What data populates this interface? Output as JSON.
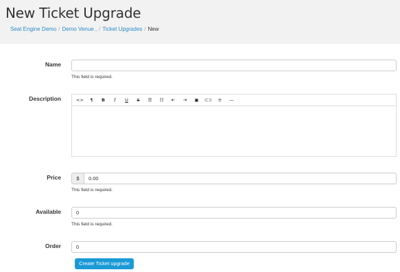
{
  "page": {
    "title": "New Ticket Upgrade"
  },
  "breadcrumb": {
    "items": [
      "Seat Engine Demo",
      "Demo Venue ,",
      "Ticket Upgrades"
    ],
    "current": "New",
    "separator": "/"
  },
  "form": {
    "name": {
      "label": "Name",
      "value": "",
      "help": "This field is required."
    },
    "description": {
      "label": "Description",
      "value": "",
      "toolbar": [
        {
          "icon": "code-icon",
          "glyph": "<>"
        },
        {
          "icon": "paragraph-icon",
          "glyph": "¶"
        },
        {
          "icon": "bold-icon",
          "glyph": "B"
        },
        {
          "icon": "italic-icon",
          "glyph": "I"
        },
        {
          "icon": "underline-icon",
          "glyph": "U"
        },
        {
          "icon": "strikethrough-icon",
          "glyph": "S"
        },
        {
          "icon": "unordered-list-icon",
          "glyph": "☰"
        },
        {
          "icon": "ordered-list-icon",
          "glyph": "☷"
        },
        {
          "icon": "outdent-icon",
          "glyph": "⇤"
        },
        {
          "icon": "indent-icon",
          "glyph": "⇥"
        },
        {
          "icon": "image-icon",
          "glyph": "▣"
        },
        {
          "icon": "link-icon",
          "glyph": "⊂⊃"
        },
        {
          "icon": "align-icon",
          "glyph": "≡"
        },
        {
          "icon": "horizontal-rule-icon",
          "glyph": "—"
        }
      ]
    },
    "price": {
      "label": "Price",
      "prefix": "$",
      "value": "0.00",
      "help": "This field is required."
    },
    "available": {
      "label": "Available",
      "value": "0",
      "help": "This field is required."
    },
    "order": {
      "label": "Order",
      "value": "0"
    },
    "submit_label": "Create Ticket upgrade"
  },
  "colors": {
    "link": "#2a8bc9",
    "primary_button": "#1a9ad6",
    "header_bg": "#f2f2f2"
  }
}
